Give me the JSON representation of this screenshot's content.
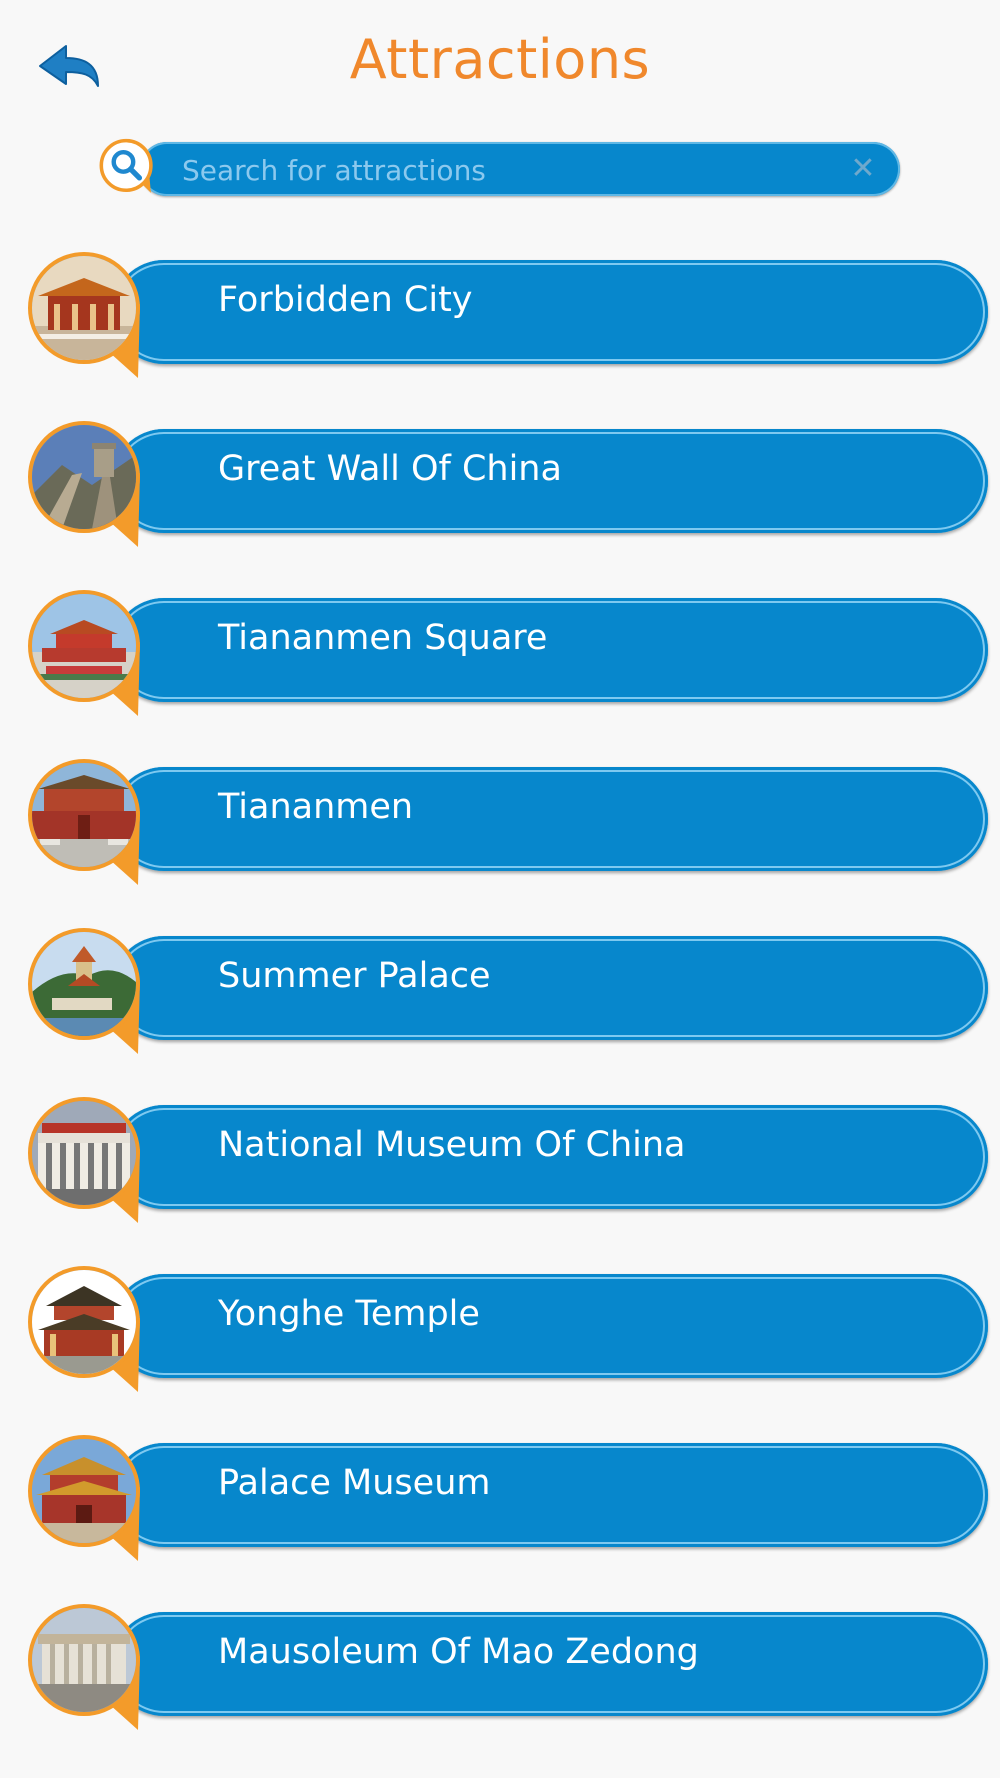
{
  "header": {
    "title": "Attractions",
    "back_icon": "back-arrow-icon"
  },
  "search": {
    "placeholder": "Search for attractions",
    "value": "",
    "clear_glyph": "✕",
    "icon": "magnifier-icon"
  },
  "colors": {
    "accent_orange": "#f0882c",
    "pill_blue": "#0787cc",
    "pill_highlight": "#7ec9f0",
    "background": "#f8f8f8"
  },
  "attractions": [
    {
      "label": "Forbidden City",
      "thumb": "forbidden-city-photo"
    },
    {
      "label": "Great Wall Of China",
      "thumb": "great-wall-photo"
    },
    {
      "label": "Tiananmen Square",
      "thumb": "tiananmen-square-photo"
    },
    {
      "label": "Tiananmen",
      "thumb": "tiananmen-photo"
    },
    {
      "label": "Summer Palace",
      "thumb": "summer-palace-photo"
    },
    {
      "label": "National Museum Of China",
      "thumb": "national-museum-photo"
    },
    {
      "label": "Yonghe Temple",
      "thumb": "yonghe-temple-photo"
    },
    {
      "label": "Palace Museum",
      "thumb": "palace-museum-photo"
    },
    {
      "label": "Mausoleum Of Mao Zedong",
      "thumb": "mausoleum-photo"
    }
  ]
}
